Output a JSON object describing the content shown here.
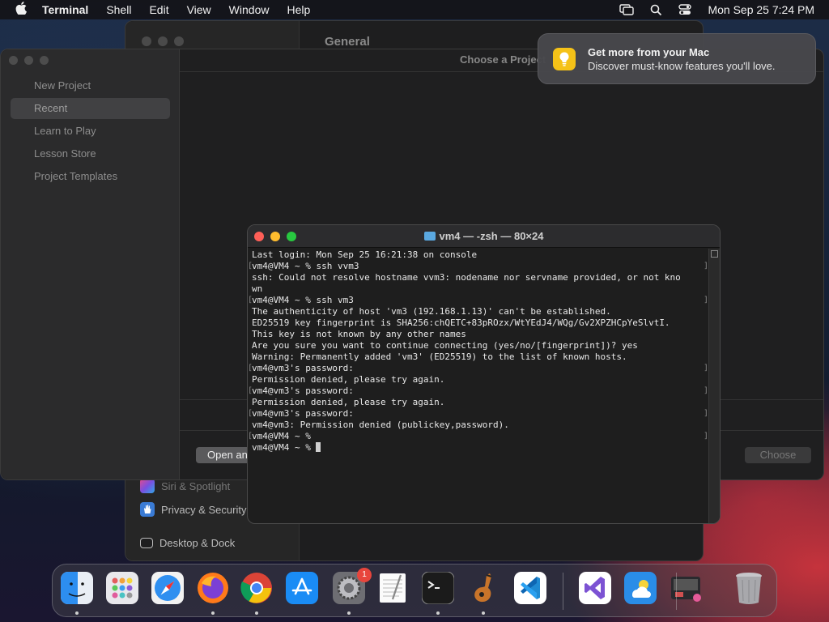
{
  "menubar": {
    "app": "Terminal",
    "items": [
      "Shell",
      "Edit",
      "View",
      "Window",
      "Help"
    ],
    "clock": "Mon Sep 25  7:24 PM"
  },
  "settings": {
    "title": "General",
    "items": [
      {
        "label": "Siri & Spotlight",
        "icon": "siri-icon"
      },
      {
        "label": "Privacy & Security",
        "icon": "hand-icon"
      },
      {
        "label": "Desktop & Dock",
        "icon": "dock-icon"
      }
    ]
  },
  "chooser": {
    "title": "Choose a Project",
    "sidebar": [
      "New Project",
      "Recent",
      "Learn to Play",
      "Lesson Store",
      "Project Templates"
    ],
    "selected": "Recent",
    "open_button": "Open an existing Project...",
    "choose_button": "Choose"
  },
  "notification": {
    "title": "Get more from your Mac",
    "body": "Discover must-know features you'll love."
  },
  "terminal": {
    "title": "vm4 — -zsh — 80×24",
    "lines": [
      {
        "text": "Last login: Mon Sep 25 16:21:38 on console",
        "mark": false
      },
      {
        "text": "vm4@VM4 ~ % ssh vvm3",
        "mark": true
      },
      {
        "text": "ssh: Could not resolve hostname vvm3: nodename nor servname provided, or not kno",
        "mark": false
      },
      {
        "text": "wn",
        "mark": false
      },
      {
        "text": "vm4@VM4 ~ % ssh vm3",
        "mark": true
      },
      {
        "text": "The authenticity of host 'vm3 (192.168.1.13)' can't be established.",
        "mark": false
      },
      {
        "text": "ED25519 key fingerprint is SHA256:chQETC+83pROzx/WtYEdJ4/WQg/Gv2XPZHCpYeSlvtI.",
        "mark": false
      },
      {
        "text": "This key is not known by any other names",
        "mark": false
      },
      {
        "text": "Are you sure you want to continue connecting (yes/no/[fingerprint])? yes",
        "mark": false
      },
      {
        "text": "Warning: Permanently added 'vm3' (ED25519) to the list of known hosts.",
        "mark": false
      },
      {
        "text": "vm4@vm3's password:",
        "mark": true
      },
      {
        "text": "Permission denied, please try again.",
        "mark": false
      },
      {
        "text": "vm4@vm3's password:",
        "mark": true
      },
      {
        "text": "Permission denied, please try again.",
        "mark": false
      },
      {
        "text": "vm4@vm3's password:",
        "mark": true
      },
      {
        "text": "vm4@vm3: Permission denied (publickey,password).",
        "mark": false
      },
      {
        "text": "vm4@VM4 ~ %",
        "mark": true
      },
      {
        "text": "vm4@VM4 ~ % ",
        "mark": false,
        "cursor": true
      }
    ]
  },
  "dock": {
    "apps": [
      {
        "name": "Finder",
        "icon": "finder-icon",
        "color": "#3d9bf0",
        "running": true
      },
      {
        "name": "Launchpad",
        "icon": "launchpad-icon",
        "color": "#e9e9ee",
        "running": false
      },
      {
        "name": "Safari",
        "icon": "safari-icon",
        "color": "#2f8ff0",
        "running": false
      },
      {
        "name": "Firefox",
        "icon": "firefox-icon",
        "color": "#6a3fc4",
        "running": true
      },
      {
        "name": "Chrome",
        "icon": "chrome-icon",
        "color": "#f2f2f2",
        "running": true
      },
      {
        "name": "App Store",
        "icon": "app-store-icon",
        "color": "#1a8cf5",
        "running": false
      },
      {
        "name": "System Settings",
        "icon": "settings-icon",
        "color": "#8a8a8f",
        "running": true,
        "badge": "1"
      },
      {
        "name": "TextEdit",
        "icon": "textedit-icon",
        "color": "#f3f3f3",
        "running": false
      },
      {
        "name": "Terminal",
        "icon": "terminal-icon",
        "color": "#1b1b1b",
        "running": true
      },
      {
        "name": "GarageBand",
        "icon": "garageband-icon",
        "color": "#7a4a22",
        "running": true
      },
      {
        "name": "Visual Studio Code",
        "icon": "vscode-icon",
        "color": "#ffffff",
        "running": false
      },
      {
        "name": "Visual Studio",
        "icon": "visual-studio-icon",
        "color": "#ffffff",
        "running": false
      },
      {
        "name": "Weather",
        "icon": "weather-icon",
        "color": "#2a8de8",
        "running": false
      },
      {
        "name": "Downloads",
        "icon": "downloads-stack-icon",
        "color": "#333",
        "running": false
      },
      {
        "name": "Trash",
        "icon": "trash-icon",
        "color": "#9a9a9e",
        "running": false
      }
    ]
  }
}
